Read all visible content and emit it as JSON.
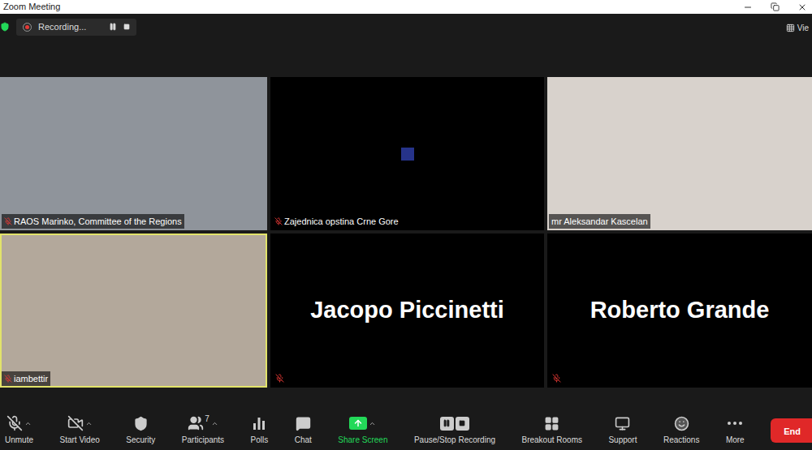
{
  "window": {
    "title": "Zoom Meeting"
  },
  "recording": {
    "label": "Recording...",
    "active": true
  },
  "view_button": {
    "label": "Vie"
  },
  "tiles": [
    {
      "name": "RAOS Marinko, Committee of the Regions",
      "muted": true,
      "active_speaker": false,
      "kind": "video"
    },
    {
      "name": "Zajednica opstina Crne Gore",
      "muted": true,
      "active_speaker": false,
      "kind": "blank"
    },
    {
      "name": "mr Aleksandar Kascelan",
      "muted": false,
      "active_speaker": false,
      "kind": "video"
    },
    {
      "name": "iambettir",
      "muted": true,
      "active_speaker": true,
      "kind": "video"
    },
    {
      "name": "Jacopo Piccinetti",
      "muted": true,
      "active_speaker": false,
      "kind": "name"
    },
    {
      "name": "Roberto Grande",
      "muted": true,
      "active_speaker": false,
      "kind": "name"
    }
  ],
  "toolbar": [
    {
      "label": "Unmute"
    },
    {
      "label": "Start Video"
    },
    {
      "label": "Security"
    },
    {
      "label": "Participants",
      "count": "7"
    },
    {
      "label": "Polls"
    },
    {
      "label": "Chat"
    },
    {
      "label": "Share Screen"
    },
    {
      "label": "Pause/Stop Recording"
    },
    {
      "label": "Breakout Rooms"
    },
    {
      "label": "Support"
    },
    {
      "label": "Reactions"
    },
    {
      "label": "More"
    }
  ],
  "end_button": {
    "label": "End"
  }
}
